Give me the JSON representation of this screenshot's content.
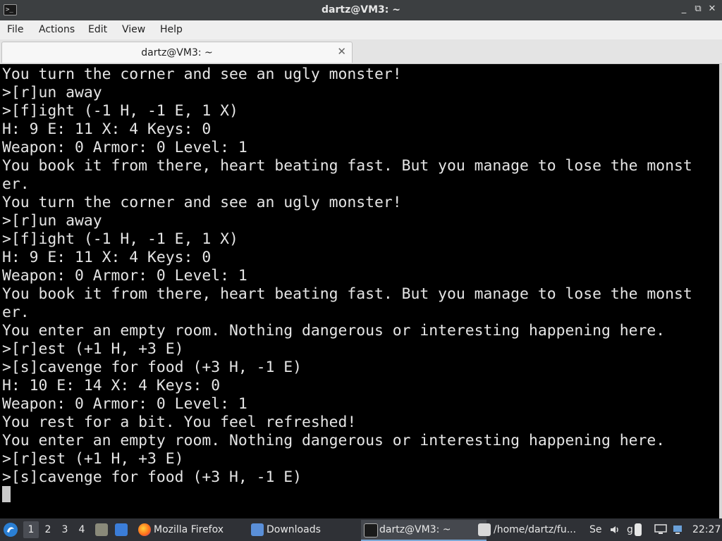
{
  "window": {
    "title": "dartz@VM3: ~",
    "controls": [
      "_",
      "⧉",
      "✕"
    ]
  },
  "menu": [
    "File",
    "Actions",
    "Edit",
    "View",
    "Help"
  ],
  "tab": {
    "title": "dartz@VM3: ~",
    "close_glyph": "✕"
  },
  "terminal": {
    "lines": [
      "You turn the corner and see an ugly monster!",
      ">[r]un away",
      ">[f]ight (-1 H, -1 E, 1 X)",
      "H: 9 E: 11 X: 4 Keys: 0",
      "Weapon: 0 Armor: 0 Level: 1",
      "You book it from there, heart beating fast. But you manage to lose the monst",
      "er.",
      "You turn the corner and see an ugly monster!",
      ">[r]un away",
      ">[f]ight (-1 H, -1 E, 1 X)",
      "H: 9 E: 11 X: 4 Keys: 0",
      "Weapon: 0 Armor: 0 Level: 1",
      "You book it from there, heart beating fast. But you manage to lose the monst",
      "er.",
      "You enter an empty room. Nothing dangerous or interesting happening here.",
      ">[r]est (+1 H, +3 E)",
      ">[s]cavenge for food (+3 H, -1 E)",
      "H: 10 E: 14 X: 4 Keys: 0",
      "Weapon: 0 Armor: 0 Level: 1",
      "You rest for a bit. You feel refreshed!",
      "You enter an empty room. Nothing dangerous or interesting happening here.",
      ">[r]est (+1 H, +3 E)",
      ">[s]cavenge for food (+3 H, -1 E)"
    ]
  },
  "taskbar": {
    "workspaces": [
      "1",
      "2",
      "3",
      "4"
    ],
    "tasks": [
      {
        "label": "Mozilla Firefox",
        "icon": "firefox-icon"
      },
      {
        "label": "Downloads",
        "icon": "folder-icon"
      },
      {
        "label": "dartz@VM3: ~",
        "icon": "terminal-icon"
      },
      {
        "label": "/home/dartz/fu...",
        "icon": "editor-icon"
      }
    ],
    "tray_partial": [
      "Se",
      "g"
    ],
    "clock": "22:27"
  }
}
